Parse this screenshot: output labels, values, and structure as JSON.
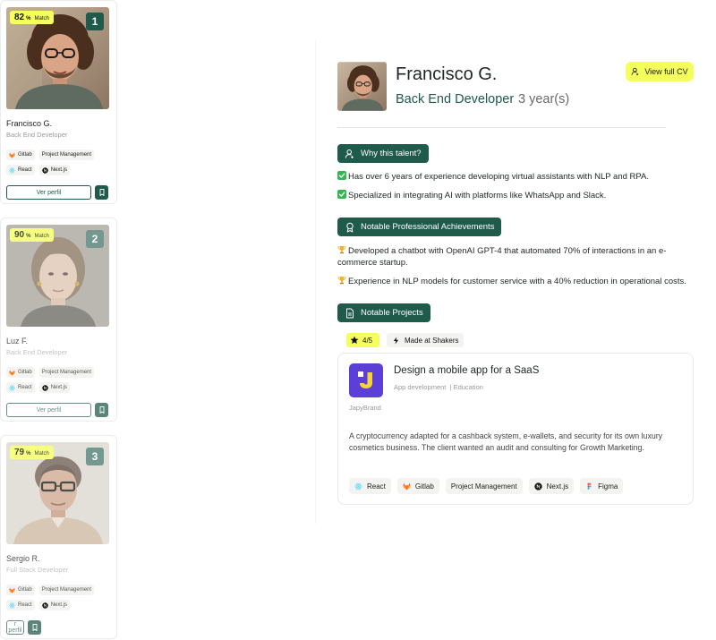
{
  "candidates": [
    {
      "name": "Francisco G.",
      "role": "Back End Developer",
      "match": "82",
      "match_unit": "%",
      "match_label": "Match",
      "rank": "1",
      "skills": [
        "Gitlab",
        "Project Management",
        "React",
        "Next.js"
      ],
      "profile_button": "Ver perfil"
    },
    {
      "name": "Luz F.",
      "role": "Back End Developer",
      "match": "90",
      "match_unit": "%",
      "match_label": "Match",
      "rank": "2",
      "skills": [
        "Gitlab",
        "Project Management",
        "React",
        "Next.js"
      ],
      "profile_button": "Ver perfil"
    },
    {
      "name": "Sergio R.",
      "role": "Full Stack Developer",
      "match": "79",
      "match_unit": "%",
      "match_label": "Match",
      "rank": "3",
      "skills": [
        "Gitlab",
        "Project Management",
        "React",
        "Next.js"
      ],
      "profile_button": "r perfil"
    }
  ],
  "detail": {
    "name": "Francisco G.",
    "role": "Back End Developer",
    "experience": "3 year(s)",
    "cv_button": "View full CV",
    "why_title": "Why this talent?",
    "why_points": [
      "Has over 6 years of experience developing virtual assistants with NLP and RPA.",
      "Specialized in integrating AI with platforms like WhatsApp and Slack."
    ],
    "achievements_title": "Notable Professional Achievements",
    "achievements": [
      "Developed a chatbot with OpenAI GPT-4 that automated 70% of interactions in an e-commerce startup.",
      "Experience in NLP models for customer service with a 40% reduction in operational costs."
    ],
    "projects_title": "Notable Projects",
    "rating": "4/5",
    "made_at": "Made at Shakers",
    "project": {
      "title": "Design a mobile app for a SaaS",
      "category": "App development",
      "category2": "| Education",
      "brand": "JapyBrand",
      "description": "A cryptocurrency adapted for a cashback system, e-wallets, and security for its own luxury cosmetics business. The client wanted an audit and consulting for Growth Marketing.",
      "tags": [
        "React",
        "Gitlab",
        "Project Management",
        "Next.js",
        "Figma"
      ]
    }
  },
  "colors": {
    "brand_green": "#1f5a4a",
    "accent_yellow": "#f4ff5c",
    "chip_bg": "#f3f3f1"
  },
  "icons": {
    "gitlab": "gitlab-icon",
    "react": "react-icon",
    "nextjs": "nextjs-icon",
    "figma": "figma-icon",
    "bookmark": "bookmark-icon",
    "user": "user-icon",
    "award": "award-icon",
    "document": "document-icon",
    "star": "star-icon",
    "bolt": "bolt-icon",
    "check": "check-emoji",
    "trophy": "trophy-emoji"
  }
}
